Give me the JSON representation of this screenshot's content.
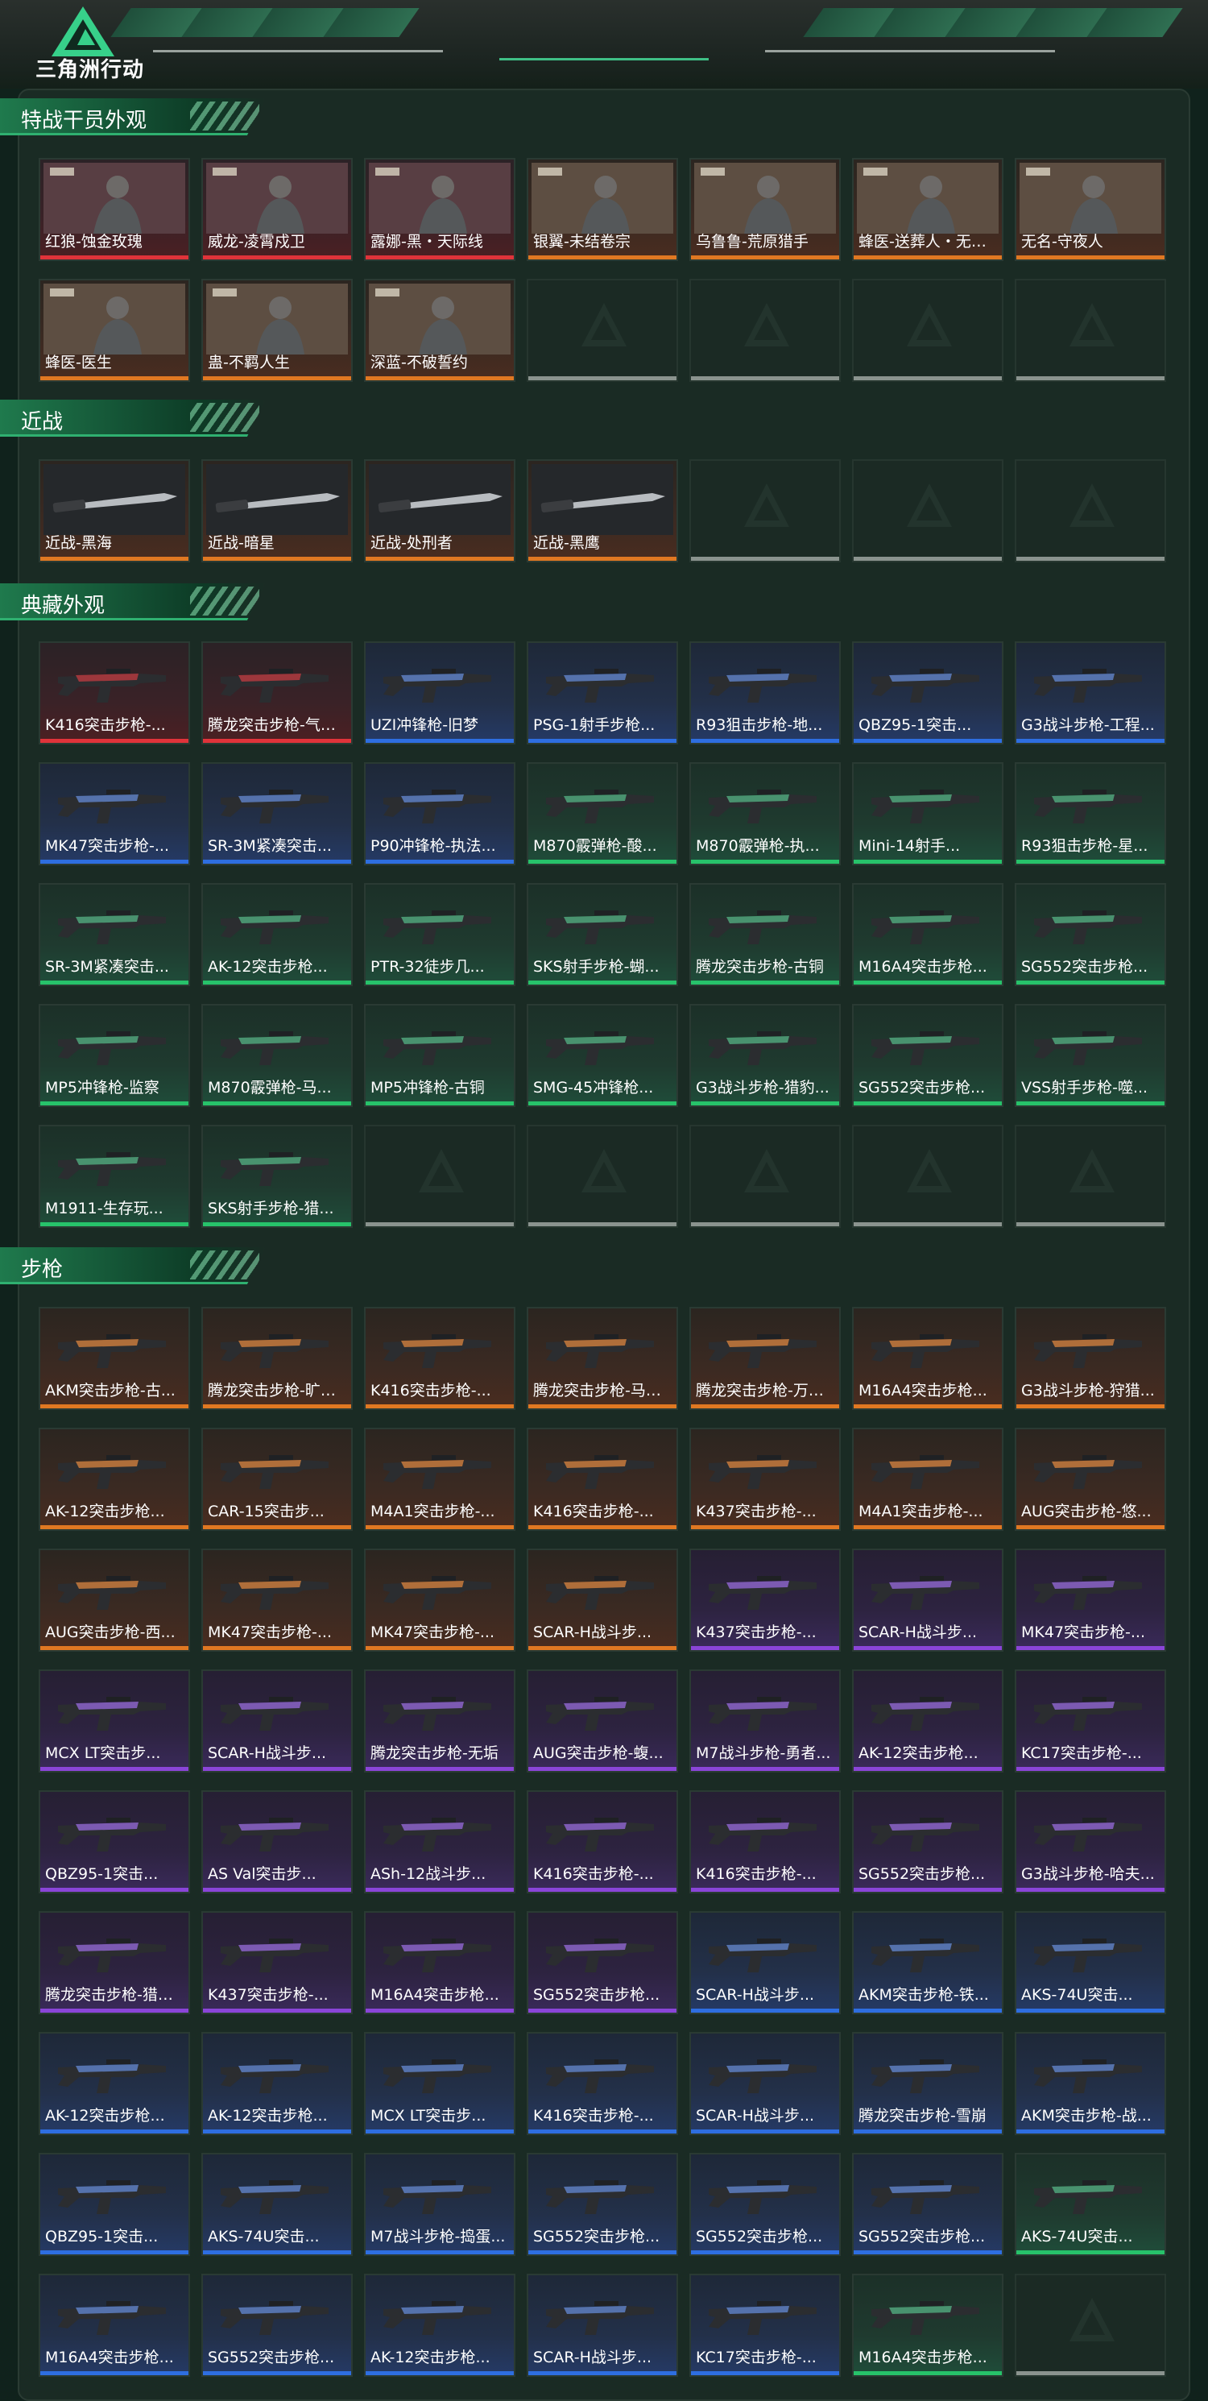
{
  "app": {
    "brand": "三角洲行动"
  },
  "colors": {
    "gold": "#e07822",
    "red": "#e0333a",
    "blue": "#2e6ee0",
    "purple": "#8a45d8",
    "green": "#27c26a",
    "empty": "#8a938e",
    "accent": "#2fb070"
  },
  "sections": [
    {
      "title": "特战干员外观",
      "items": [
        {
          "label": "红狼-蚀金玫瑰",
          "rarity": "red",
          "kind": "operator"
        },
        {
          "label": "威龙-凌霄戍卫",
          "rarity": "red",
          "kind": "operator"
        },
        {
          "label": "露娜-黑・天际线",
          "rarity": "red",
          "kind": "operator"
        },
        {
          "label": "银翼-未结卷宗",
          "rarity": "orange",
          "kind": "operator"
        },
        {
          "label": "乌鲁鲁-荒原猎手",
          "rarity": "orange",
          "kind": "operator"
        },
        {
          "label": "蜂医-送葬人・无题...",
          "rarity": "orange",
          "kind": "operator"
        },
        {
          "label": "无名-守夜人",
          "rarity": "orange",
          "kind": "operator"
        },
        {
          "label": "蜂医-医生",
          "rarity": "orange",
          "kind": "operator"
        },
        {
          "label": "蛊-不羁人生",
          "rarity": "orange",
          "kind": "operator"
        },
        {
          "label": "深蓝-不破誓约",
          "rarity": "orange",
          "kind": "operator"
        },
        {
          "label": "",
          "rarity": "empty",
          "kind": "empty"
        },
        {
          "label": "",
          "rarity": "empty",
          "kind": "empty"
        },
        {
          "label": "",
          "rarity": "empty",
          "kind": "empty"
        },
        {
          "label": "",
          "rarity": "empty",
          "kind": "empty"
        }
      ]
    },
    {
      "title": "近战",
      "items": [
        {
          "label": "近战-黑海",
          "rarity": "orange",
          "kind": "melee"
        },
        {
          "label": "近战-暗星",
          "rarity": "orange",
          "kind": "melee"
        },
        {
          "label": "近战-处刑者",
          "rarity": "orange",
          "kind": "melee"
        },
        {
          "label": "近战-黑鹰",
          "rarity": "orange",
          "kind": "melee"
        },
        {
          "label": "",
          "rarity": "empty",
          "kind": "empty"
        },
        {
          "label": "",
          "rarity": "empty",
          "kind": "empty"
        },
        {
          "label": "",
          "rarity": "empty",
          "kind": "empty"
        }
      ]
    },
    {
      "title": "典藏外观",
      "items": [
        {
          "label": "K416突击步枪-...",
          "rarity": "red",
          "kind": "gun"
        },
        {
          "label": "腾龙突击步枪-气象...",
          "rarity": "red",
          "kind": "gun"
        },
        {
          "label": "UZI冲锋枪-旧梦",
          "rarity": "blue",
          "kind": "gun"
        },
        {
          "label": "PSG-1射手步枪...",
          "rarity": "blue",
          "kind": "gun"
        },
        {
          "label": "R93狙击步枪-地...",
          "rarity": "blue",
          "kind": "gun"
        },
        {
          "label": "QBZ95-1突击...",
          "rarity": "blue",
          "kind": "gun"
        },
        {
          "label": "G3战斗步枪-工程...",
          "rarity": "blue",
          "kind": "gun"
        },
        {
          "label": "MK47突击步枪-...",
          "rarity": "blue",
          "kind": "gun"
        },
        {
          "label": "SR-3M紧凑突击...",
          "rarity": "blue",
          "kind": "gun"
        },
        {
          "label": "P90冲锋枪-执法...",
          "rarity": "blue",
          "kind": "gun"
        },
        {
          "label": "M870霰弹枪-酸...",
          "rarity": "green",
          "kind": "gun"
        },
        {
          "label": "M870霰弹枪-执...",
          "rarity": "green",
          "kind": "gun"
        },
        {
          "label": "Mini-14射手...",
          "rarity": "green",
          "kind": "gun"
        },
        {
          "label": "R93狙击步枪-星...",
          "rarity": "green",
          "kind": "gun"
        },
        {
          "label": "SR-3M紧凑突击...",
          "rarity": "green",
          "kind": "gun"
        },
        {
          "label": "AK-12突击步枪...",
          "rarity": "green",
          "kind": "gun"
        },
        {
          "label": "PTR-32徒步几...",
          "rarity": "green",
          "kind": "gun"
        },
        {
          "label": "SKS射手步枪-蝴...",
          "rarity": "green",
          "kind": "gun"
        },
        {
          "label": "腾龙突击步枪-古铜",
          "rarity": "green",
          "kind": "gun"
        },
        {
          "label": "M16A4突击步枪...",
          "rarity": "green",
          "kind": "gun"
        },
        {
          "label": "SG552突击步枪...",
          "rarity": "green",
          "kind": "gun"
        },
        {
          "label": "MP5冲锋枪-监察",
          "rarity": "green",
          "kind": "gun"
        },
        {
          "label": "M870霰弹枪-马...",
          "rarity": "green",
          "kind": "gun"
        },
        {
          "label": "MP5冲锋枪-古铜",
          "rarity": "green",
          "kind": "gun"
        },
        {
          "label": "SMG-45冲锋枪...",
          "rarity": "green",
          "kind": "gun"
        },
        {
          "label": "G3战斗步枪-猎豹...",
          "rarity": "green",
          "kind": "gun"
        },
        {
          "label": "SG552突击步枪...",
          "rarity": "green",
          "kind": "gun"
        },
        {
          "label": "VSS射手步枪-噬...",
          "rarity": "green",
          "kind": "gun"
        },
        {
          "label": "M1911-生存玩...",
          "rarity": "green",
          "kind": "gun"
        },
        {
          "label": "SKS射手步枪-猎...",
          "rarity": "green",
          "kind": "gun"
        },
        {
          "label": "",
          "rarity": "empty",
          "kind": "empty"
        },
        {
          "label": "",
          "rarity": "empty",
          "kind": "empty"
        },
        {
          "label": "",
          "rarity": "empty",
          "kind": "empty"
        },
        {
          "label": "",
          "rarity": "empty",
          "kind": "empty"
        },
        {
          "label": "",
          "rarity": "empty",
          "kind": "empty"
        }
      ]
    },
    {
      "title": "步枪",
      "items": [
        {
          "label": "AKM突击步枪-古...",
          "rarity": "orange",
          "kind": "gun"
        },
        {
          "label": "腾龙突击步枪-旷野...",
          "rarity": "orange",
          "kind": "gun"
        },
        {
          "label": "K416突击步枪-...",
          "rarity": "orange",
          "kind": "gun"
        },
        {
          "label": "腾龙突击步枪-马年...",
          "rarity": "orange",
          "kind": "gun"
        },
        {
          "label": "腾龙突击步枪-万金...",
          "rarity": "orange",
          "kind": "gun"
        },
        {
          "label": "M16A4突击步枪...",
          "rarity": "orange",
          "kind": "gun"
        },
        {
          "label": "G3战斗步枪-狩猎...",
          "rarity": "orange",
          "kind": "gun"
        },
        {
          "label": "AK-12突击步枪...",
          "rarity": "orange",
          "kind": "gun"
        },
        {
          "label": "CAR-15突击步...",
          "rarity": "orange",
          "kind": "gun"
        },
        {
          "label": "M4A1突击步枪-...",
          "rarity": "orange",
          "kind": "gun"
        },
        {
          "label": "K416突击步枪-...",
          "rarity": "orange",
          "kind": "gun"
        },
        {
          "label": "K437突击步枪-...",
          "rarity": "orange",
          "kind": "gun"
        },
        {
          "label": "M4A1突击步枪-...",
          "rarity": "orange",
          "kind": "gun"
        },
        {
          "label": "AUG突击步枪-悠...",
          "rarity": "orange",
          "kind": "gun"
        },
        {
          "label": "AUG突击步枪-西...",
          "rarity": "orange",
          "kind": "gun"
        },
        {
          "label": "MK47突击步枪-...",
          "rarity": "orange",
          "kind": "gun"
        },
        {
          "label": "MK47突击步枪-...",
          "rarity": "orange",
          "kind": "gun"
        },
        {
          "label": "SCAR-H战斗步...",
          "rarity": "orange",
          "kind": "gun"
        },
        {
          "label": "K437突击步枪-...",
          "rarity": "purple",
          "kind": "gun"
        },
        {
          "label": "SCAR-H战斗步...",
          "rarity": "purple",
          "kind": "gun"
        },
        {
          "label": "MK47突击步枪-...",
          "rarity": "purple",
          "kind": "gun"
        },
        {
          "label": "MCX LT突击步...",
          "rarity": "purple",
          "kind": "gun"
        },
        {
          "label": "SCAR-H战斗步...",
          "rarity": "purple",
          "kind": "gun"
        },
        {
          "label": "腾龙突击步枪-无垢",
          "rarity": "purple",
          "kind": "gun"
        },
        {
          "label": "AUG突击步枪-蝮...",
          "rarity": "purple",
          "kind": "gun"
        },
        {
          "label": "M7战斗步枪-勇者...",
          "rarity": "purple",
          "kind": "gun"
        },
        {
          "label": "AK-12突击步枪...",
          "rarity": "purple",
          "kind": "gun"
        },
        {
          "label": "KC17突击步枪-...",
          "rarity": "purple",
          "kind": "gun"
        },
        {
          "label": "QBZ95-1突击...",
          "rarity": "purple",
          "kind": "gun"
        },
        {
          "label": "AS Val突击步...",
          "rarity": "purple",
          "kind": "gun"
        },
        {
          "label": "ASh-12战斗步...",
          "rarity": "purple",
          "kind": "gun"
        },
        {
          "label": "K416突击步枪-...",
          "rarity": "purple",
          "kind": "gun"
        },
        {
          "label": "K416突击步枪-...",
          "rarity": "purple",
          "kind": "gun"
        },
        {
          "label": "SG552突击步枪...",
          "rarity": "purple",
          "kind": "gun"
        },
        {
          "label": "G3战斗步枪-哈夫...",
          "rarity": "purple",
          "kind": "gun"
        },
        {
          "label": "腾龙突击步枪-猎鳄...",
          "rarity": "purple",
          "kind": "gun"
        },
        {
          "label": "K437突击步枪-...",
          "rarity": "purple",
          "kind": "gun"
        },
        {
          "label": "M16A4突击步枪...",
          "rarity": "purple",
          "kind": "gun"
        },
        {
          "label": "SG552突击步枪...",
          "rarity": "purple",
          "kind": "gun"
        },
        {
          "label": "SCAR-H战斗步...",
          "rarity": "blue",
          "kind": "gun"
        },
        {
          "label": "AKM突击步枪-铁...",
          "rarity": "blue",
          "kind": "gun"
        },
        {
          "label": "AKS-74U突击...",
          "rarity": "blue",
          "kind": "gun"
        },
        {
          "label": "AK-12突击步枪...",
          "rarity": "blue",
          "kind": "gun"
        },
        {
          "label": "AK-12突击步枪...",
          "rarity": "blue",
          "kind": "gun"
        },
        {
          "label": "MCX LT突击步...",
          "rarity": "blue",
          "kind": "gun"
        },
        {
          "label": "K416突击步枪-...",
          "rarity": "blue",
          "kind": "gun"
        },
        {
          "label": "SCAR-H战斗步...",
          "rarity": "blue",
          "kind": "gun"
        },
        {
          "label": "腾龙突击步枪-雪崩",
          "rarity": "blue",
          "kind": "gun"
        },
        {
          "label": "AKM突击步枪-战...",
          "rarity": "blue",
          "kind": "gun"
        },
        {
          "label": "QBZ95-1突击...",
          "rarity": "blue",
          "kind": "gun"
        },
        {
          "label": "AKS-74U突击...",
          "rarity": "blue",
          "kind": "gun"
        },
        {
          "label": "M7战斗步枪-捣蛋...",
          "rarity": "blue",
          "kind": "gun"
        },
        {
          "label": "SG552突击步枪...",
          "rarity": "blue",
          "kind": "gun"
        },
        {
          "label": "SG552突击步枪...",
          "rarity": "blue",
          "kind": "gun"
        },
        {
          "label": "SG552突击步枪...",
          "rarity": "blue",
          "kind": "gun"
        },
        {
          "label": "AKS-74U突击...",
          "rarity": "green",
          "kind": "gun"
        },
        {
          "label": "M16A4突击步枪...",
          "rarity": "blue",
          "kind": "gun"
        },
        {
          "label": "SG552突击步枪...",
          "rarity": "blue",
          "kind": "gun"
        },
        {
          "label": "AK-12突击步枪...",
          "rarity": "blue",
          "kind": "gun"
        },
        {
          "label": "SCAR-H战斗步...",
          "rarity": "blue",
          "kind": "gun"
        },
        {
          "label": "KC17突击步枪-...",
          "rarity": "blue",
          "kind": "gun"
        },
        {
          "label": "M16A4突击步枪...",
          "rarity": "green",
          "kind": "gun"
        },
        {
          "label": "",
          "rarity": "empty",
          "kind": "empty"
        }
      ]
    }
  ]
}
